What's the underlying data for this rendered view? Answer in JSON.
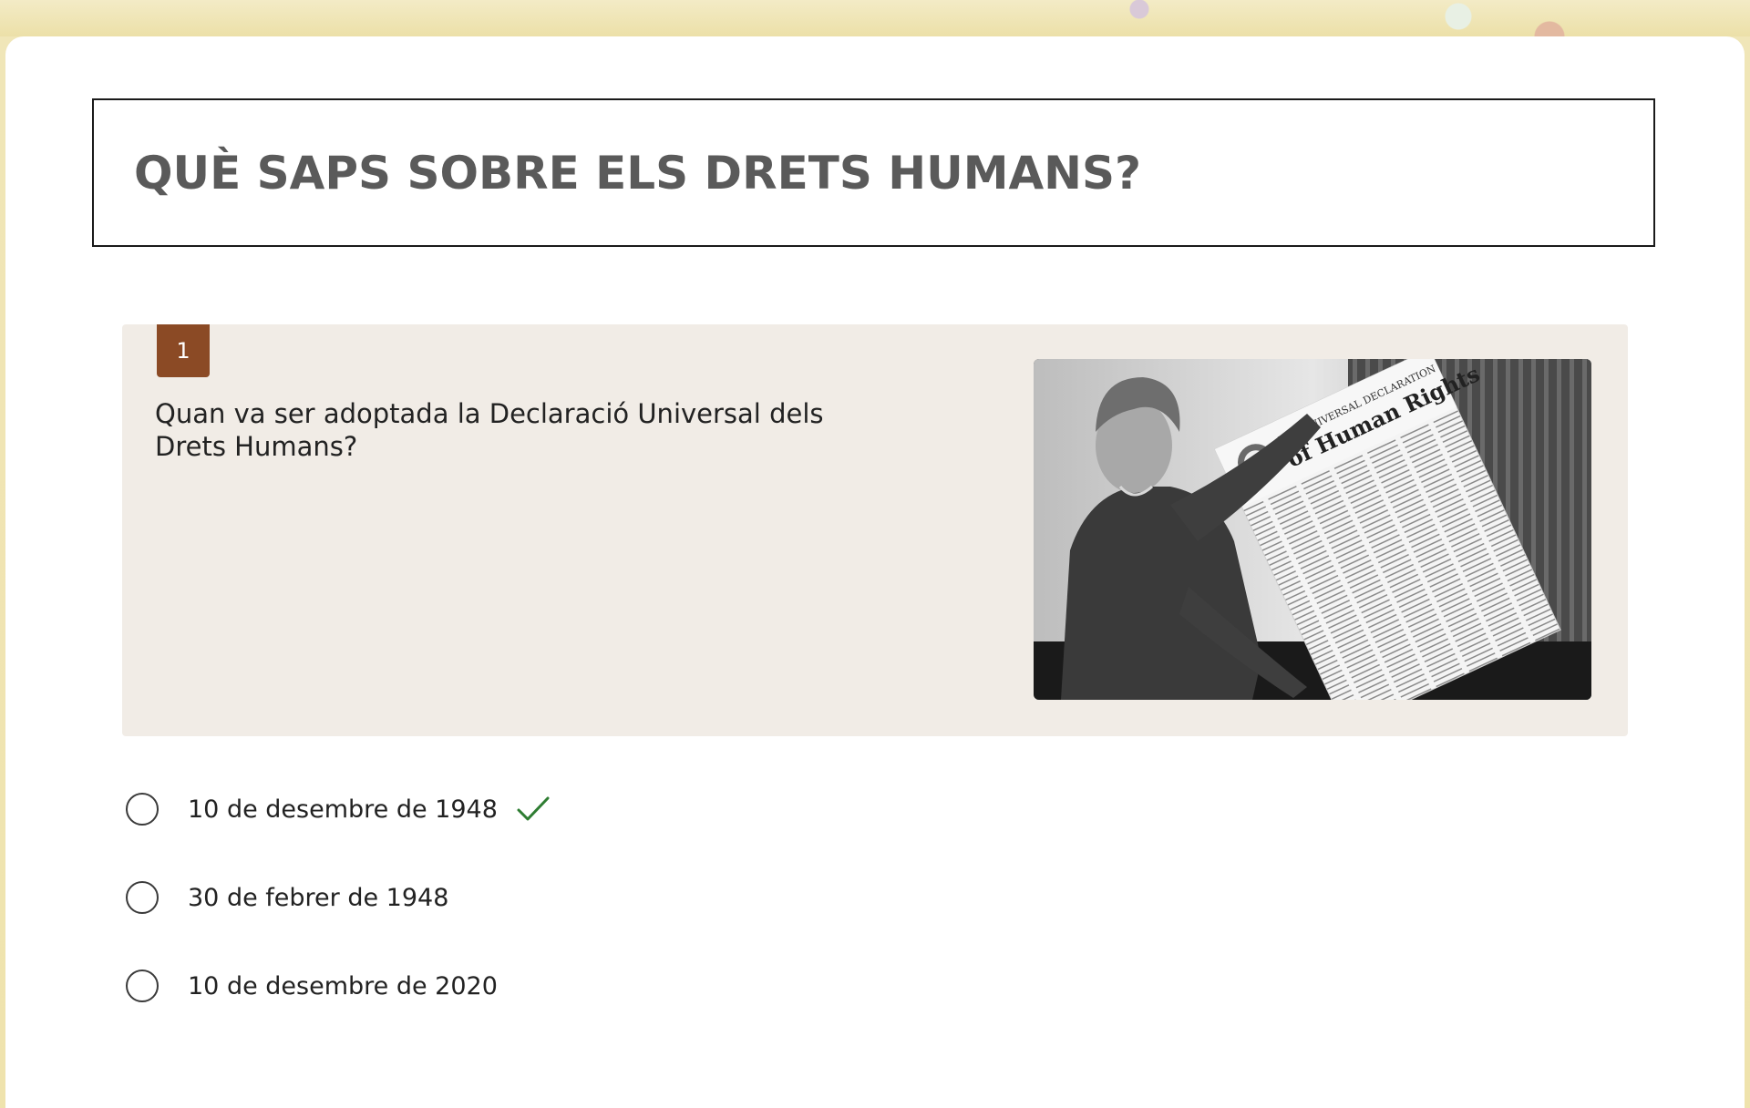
{
  "quiz": {
    "title": "QUÈ SAPS SOBRE ELS DRETS HUMANS?"
  },
  "question": {
    "number": "1",
    "text": "Quan va ser adoptada la Declaració Universal dels Drets Humans?",
    "image": {
      "poster_lines": [
        "THE UNIVERSAL DECLARATION",
        "of Human Rights"
      ]
    }
  },
  "options": [
    {
      "label": "10 de desembre de 1948",
      "correct": true
    },
    {
      "label": "30 de febrer de 1948",
      "correct": false
    },
    {
      "label": "10 de desembre de 2020",
      "correct": false
    }
  ],
  "colors": {
    "badge": "#8b4a25",
    "panel": "#f1ece6",
    "correct_check": "#2e7d32",
    "title_text": "#5a5a5a"
  },
  "icons": {
    "correct": "checkmark-icon"
  }
}
